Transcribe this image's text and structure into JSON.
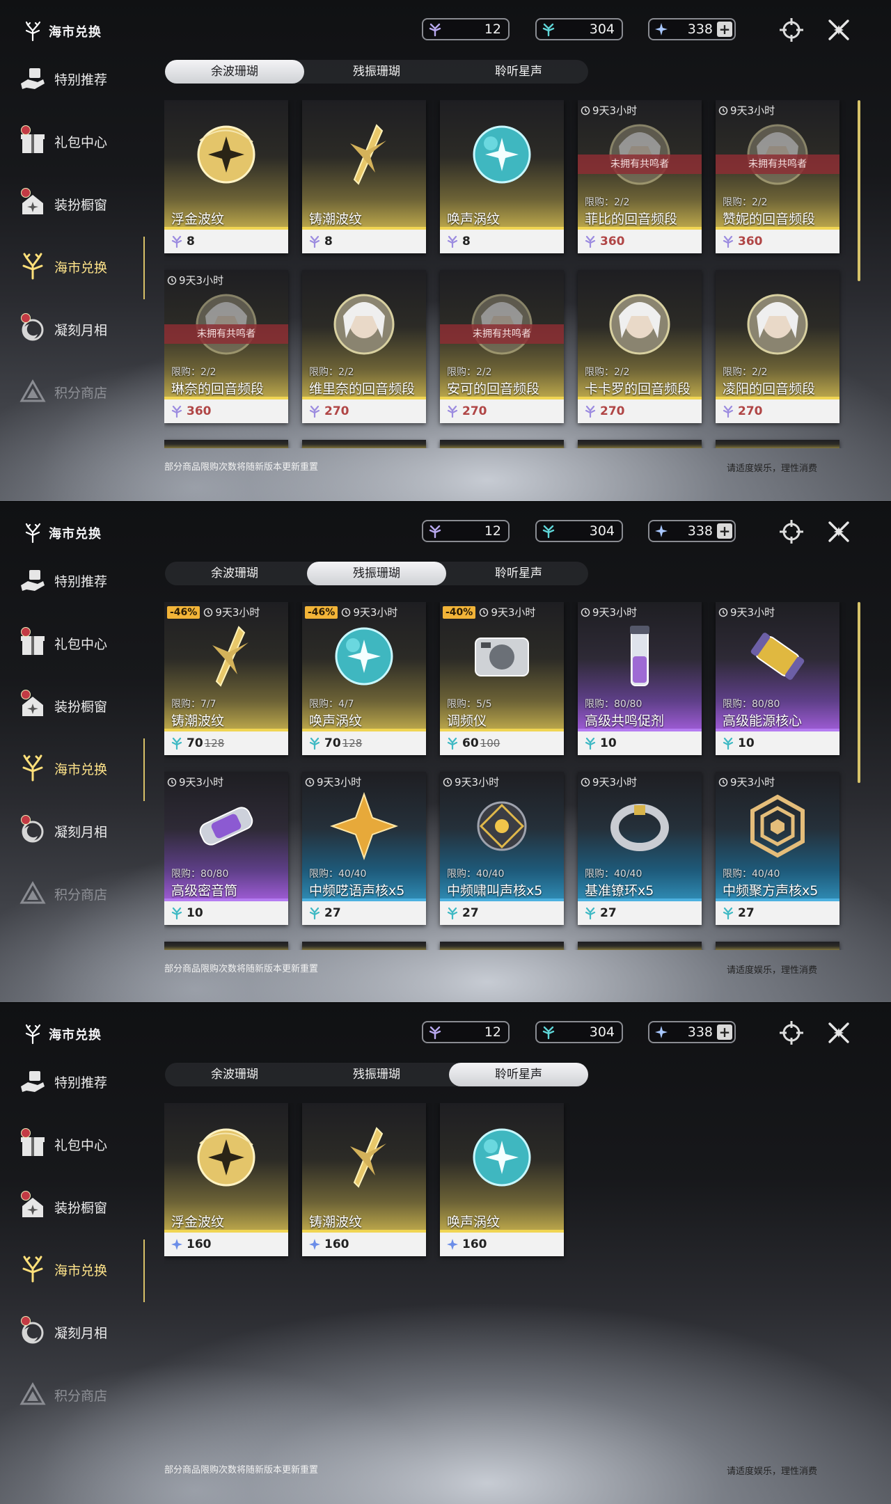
{
  "brand_title": "海市兑换",
  "currencies": [
    "12",
    "304",
    "338"
  ],
  "nav": [
    "特别推荐",
    "礼包中心",
    "装扮橱窗",
    "海市兑换",
    "凝刻月相",
    "积分商店"
  ],
  "tabs": [
    "余波珊瑚",
    "残振珊瑚",
    "聆听星声"
  ],
  "footer_note": "部分商品限购次数将随新版本更新重置",
  "footer_right": "请适度娱乐，理性消费",
  "colors": {
    "accent_gold": "#f0d553",
    "accent_purple": "#b57cf2",
    "accent_blue": "#4cb1e0",
    "price_red": "#b04646",
    "discount": "#f2b438"
  },
  "panel1": {
    "selected_tab": 0,
    "cards": [
      {
        "name": "浮金波纹",
        "price": "8",
        "time": "",
        "limit": "",
        "ribbon": "",
        "color": "gold",
        "art": "golden-orb"
      },
      {
        "name": "铸潮波纹",
        "price": "8",
        "time": "",
        "limit": "",
        "ribbon": "",
        "color": "gold",
        "art": "golden-blade"
      },
      {
        "name": "唤声涡纹",
        "price": "8",
        "time": "",
        "limit": "",
        "ribbon": "",
        "color": "gold",
        "art": "teal-orb"
      },
      {
        "name": "菲比的回音频段",
        "price": "360",
        "time": "9天3小时",
        "limit": "限购：2/2",
        "ribbon": "未拥有共鸣者",
        "color": "gold",
        "art": "portrait"
      },
      {
        "name": "赞妮的回音频段",
        "price": "360",
        "time": "9天3小时",
        "limit": "限购：2/2",
        "ribbon": "未拥有共鸣者",
        "color": "gold",
        "art": "portrait"
      },
      {
        "name": "琳奈的回音频段",
        "price": "360",
        "time": "9天3小时",
        "limit": "限购：2/2",
        "ribbon": "未拥有共鸣者",
        "color": "gold",
        "art": "portrait"
      },
      {
        "name": "维里奈的回音频段",
        "price": "270",
        "time": "",
        "limit": "限购：2/2",
        "ribbon": "",
        "color": "gold",
        "art": "portrait"
      },
      {
        "name": "安可的回音频段",
        "price": "270",
        "time": "",
        "limit": "限购：2/2",
        "ribbon": "未拥有共鸣者",
        "color": "gold",
        "art": "portrait"
      },
      {
        "name": "卡卡罗的回音频段",
        "price": "270",
        "time": "",
        "limit": "限购：2/2",
        "ribbon": "",
        "color": "gold",
        "art": "portrait"
      },
      {
        "name": "凌阳的回音频段",
        "price": "270",
        "time": "",
        "limit": "限购：2/2",
        "ribbon": "",
        "color": "gold",
        "art": "portrait"
      }
    ]
  },
  "panel2": {
    "selected_tab": 1,
    "cards": [
      {
        "name": "铸潮波纹",
        "price": "70",
        "old_price": "128",
        "discount": "-46%",
        "time": "9天3小时",
        "limit": "限购：7/7",
        "color": "gold",
        "art": "golden-blade"
      },
      {
        "name": "唤声涡纹",
        "price": "70",
        "old_price": "128",
        "discount": "-46%",
        "time": "9天3小时",
        "limit": "限购：4/7",
        "color": "gold",
        "art": "teal-orb"
      },
      {
        "name": "调频仪",
        "price": "60",
        "old_price": "100",
        "discount": "-40%",
        "time": "9天3小时",
        "limit": "限购：5/5",
        "color": "gold",
        "art": "device"
      },
      {
        "name": "高级共鸣促剂",
        "price": "10",
        "old_price": "",
        "discount": "",
        "time": "9天3小时",
        "limit": "限购：80/80",
        "color": "purple",
        "art": "vial"
      },
      {
        "name": "高级能源核心",
        "price": "10",
        "old_price": "",
        "discount": "",
        "time": "9天3小时",
        "limit": "限购：80/80",
        "color": "purple",
        "art": "capsule"
      },
      {
        "name": "高级密音筒",
        "price": "10",
        "old_price": "",
        "discount": "",
        "time": "9天3小时",
        "limit": "限购：80/80",
        "color": "purple",
        "art": "cylinder"
      },
      {
        "name": "中频呓语声核x5",
        "price": "27",
        "old_price": "",
        "discount": "",
        "time": "9天3小时",
        "limit": "限购：40/40",
        "color": "blue",
        "art": "star"
      },
      {
        "name": "中频啸叫声核x5",
        "price": "27",
        "old_price": "",
        "discount": "",
        "time": "9天3小时",
        "limit": "限购：40/40",
        "color": "blue",
        "art": "dark-orb"
      },
      {
        "name": "基准镣环x5",
        "price": "27",
        "old_price": "",
        "discount": "",
        "time": "9天3小时",
        "limit": "限购：40/40",
        "color": "blue",
        "art": "ring"
      },
      {
        "name": "中频聚方声核x5",
        "price": "27",
        "old_price": "",
        "discount": "",
        "time": "9天3小时",
        "limit": "限购：40/40",
        "color": "blue",
        "art": "hexagon"
      }
    ]
  },
  "panel3": {
    "selected_tab": 2,
    "cards": [
      {
        "name": "浮金波纹",
        "price": "160",
        "color": "gold",
        "art": "golden-orb"
      },
      {
        "name": "铸潮波纹",
        "price": "160",
        "color": "gold",
        "art": "golden-blade"
      },
      {
        "name": "唤声涡纹",
        "price": "160",
        "color": "gold",
        "art": "teal-orb"
      }
    ]
  }
}
